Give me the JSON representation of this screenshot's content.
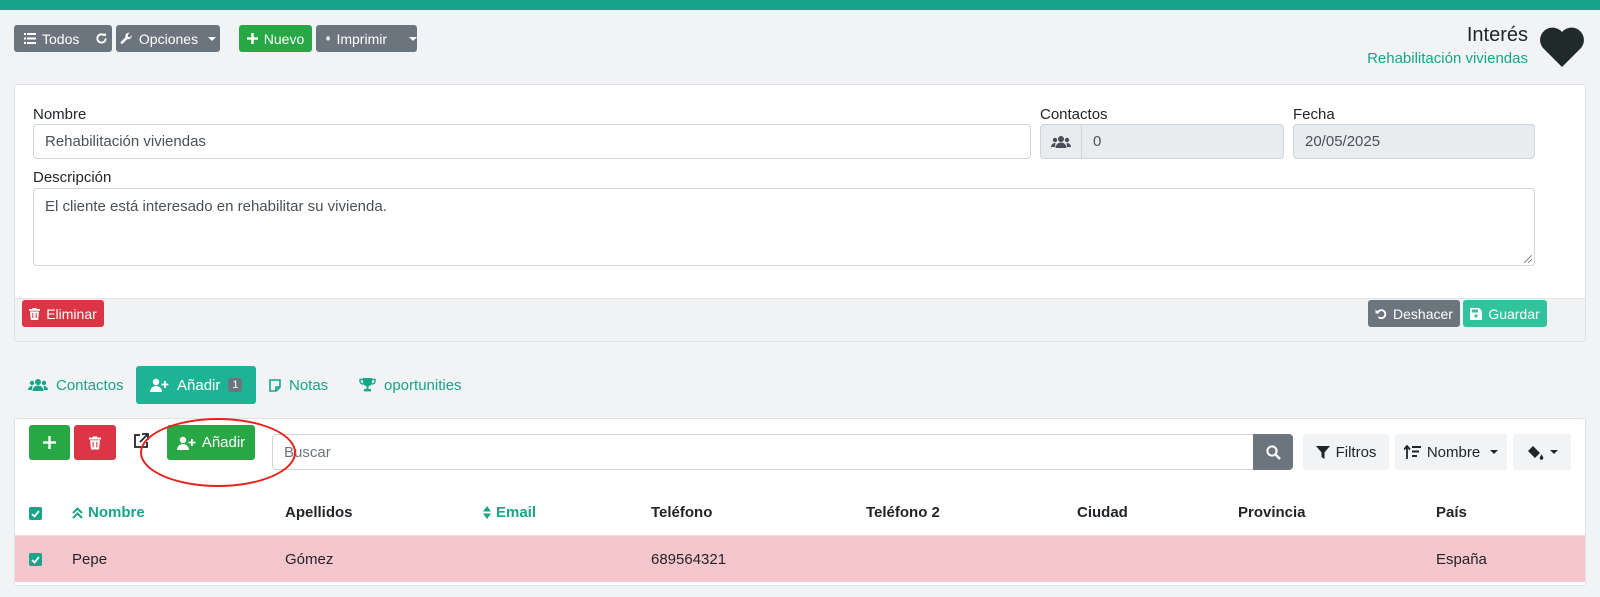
{
  "toolbar": {
    "todos_label": "Todos",
    "opciones_label": "Opciones",
    "nuevo_label": "Nuevo",
    "imprimir_label": "Imprimir"
  },
  "header": {
    "title": "Interés",
    "subtitle": "Rehabilitación viviendas"
  },
  "form": {
    "nombre_label": "Nombre",
    "nombre_value": "Rehabilitación viviendas",
    "contactos_label": "Contactos",
    "contactos_value": "0",
    "fecha_label": "Fecha",
    "fecha_value": "20/05/2025",
    "descripcion_label": "Descripción",
    "descripcion_value": "El cliente está interesado en rehabilitar su vivienda."
  },
  "footer": {
    "eliminar_label": "Eliminar",
    "deshacer_label": "Deshacer",
    "guardar_label": "Guardar"
  },
  "tabs": [
    {
      "label": "Contactos"
    },
    {
      "label": "Añadir",
      "badge": "1"
    },
    {
      "label": "Notas"
    },
    {
      "label": "oportunities"
    }
  ],
  "list_toolbar": {
    "anadir_label": "Añadir",
    "search_placeholder": "Buscar",
    "filtros_label": "Filtros",
    "order_label": "Nombre"
  },
  "table": {
    "columns": [
      "Nombre",
      "Apellidos",
      "Email",
      "Teléfono",
      "Teléfono 2",
      "Ciudad",
      "Provincia",
      "País"
    ],
    "rows": [
      {
        "nombre": "Pepe",
        "apellidos": "Gómez",
        "email": "",
        "telefono": "689564321",
        "telefono2": "",
        "ciudad": "",
        "provincia": "",
        "pais": "España"
      }
    ]
  },
  "colors": {
    "accent": "#17a589",
    "success": "#28a745",
    "danger": "#dc3545",
    "secondary": "#6c757d",
    "selected_row": "#f5c6cb",
    "annotation": "#e8221b"
  }
}
